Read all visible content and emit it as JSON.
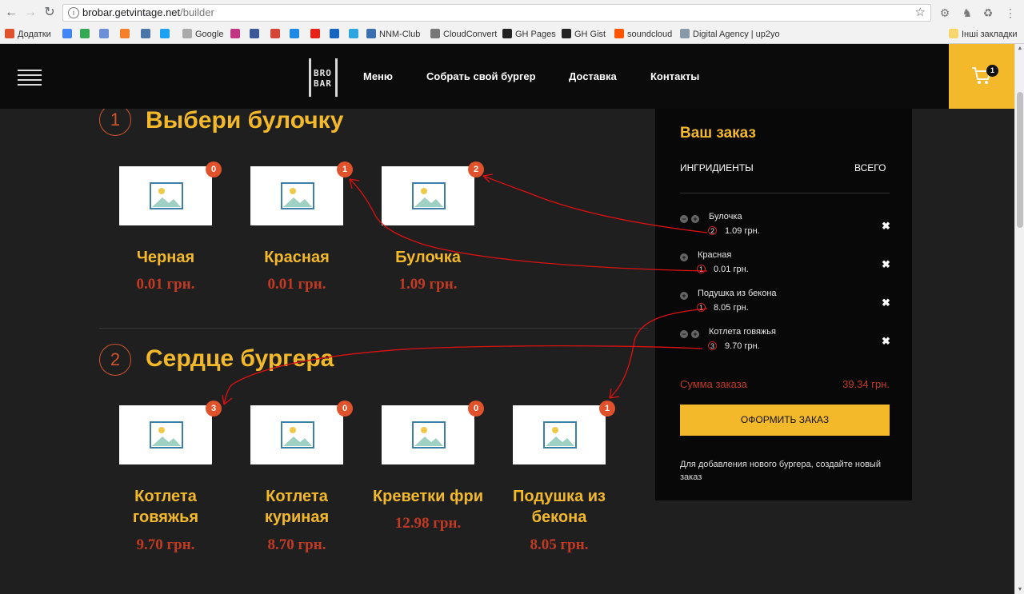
{
  "browser": {
    "url_host": "brobar.getvintage.net",
    "url_path": "/builder",
    "back_icon": "back-arrow-icon",
    "forward_icon": "forward-arrow-icon",
    "reload_icon": "reload-icon",
    "bookmarks": [
      {
        "label": "Додатки",
        "color": "#e0522b"
      },
      {
        "label": "",
        "color": "#4285f4"
      },
      {
        "label": "",
        "color": "#34a853"
      },
      {
        "label": "",
        "color": "#6d8fd8"
      },
      {
        "label": "",
        "color": "#f4802a"
      },
      {
        "label": "",
        "color": "#4a76a8"
      },
      {
        "label": "",
        "color": "#1da1f2"
      },
      {
        "label": "Google",
        "color": "#aaaaaa"
      },
      {
        "label": "",
        "color": "#c13584"
      },
      {
        "label": "",
        "color": "#3b5998"
      },
      {
        "label": "",
        "color": "#d44638"
      },
      {
        "label": "",
        "color": "#1e88e5"
      },
      {
        "label": "",
        "color": "#e62117"
      },
      {
        "label": "",
        "color": "#1565c0"
      },
      {
        "label": "",
        "color": "#2ca5e0"
      },
      {
        "label": "NNM-Club",
        "color": "#3a6fb0"
      },
      {
        "label": "CloudConvert",
        "color": "#777777"
      },
      {
        "label": "GH Pages",
        "color": "#222222"
      },
      {
        "label": "GH Gist",
        "color": "#222222"
      },
      {
        "label": "soundcloud",
        "color": "#ff5500"
      },
      {
        "label": "Digital Agency | up2yo",
        "color": "#8899aa"
      }
    ],
    "other_bookmarks": "Інші закладки"
  },
  "header": {
    "logo_line1": "BRO",
    "logo_line2": "BAR",
    "nav": [
      "Меню",
      "Собрать свой бургер",
      "Доставка",
      "Контакты"
    ],
    "cart_count": "1"
  },
  "sections": [
    {
      "number": "1",
      "title": "Выбери булочку",
      "items": [
        {
          "name": "Черная",
          "price": "0.01 грн.",
          "qty": "0"
        },
        {
          "name": "Красная",
          "price": "0.01 грн.",
          "qty": "1"
        },
        {
          "name": "Булочка",
          "price": "1.09 грн.",
          "qty": "2"
        }
      ]
    },
    {
      "number": "2",
      "title": "Сердце бургера",
      "items": [
        {
          "name": "Котлета говяжья",
          "price": "9.70 грн.",
          "qty": "3"
        },
        {
          "name": "Котлета куриная",
          "price": "8.70 грн.",
          "qty": "0"
        },
        {
          "name": "Креветки фри",
          "price": "12.98 грн.",
          "qty": "0"
        },
        {
          "name": "Подушка из бекона",
          "price": "8.05 грн.",
          "qty": "1"
        }
      ]
    }
  ],
  "order": {
    "title": "Ваш заказ",
    "col_ingredients": "ИНГРИДИЕНТЫ",
    "col_total": "ВСЕГО",
    "lines": [
      {
        "name": "Булочка",
        "count": "2",
        "price": "1.09 грн.",
        "remove": "✖"
      },
      {
        "name": "Красная",
        "count": "1",
        "price": "0.01 грн.",
        "remove": "✖"
      },
      {
        "name": "Подушка из бекона",
        "count": "1",
        "price": "8.05 грн.",
        "remove": "✖"
      },
      {
        "name": "Котлета говяжья",
        "count": "3",
        "price": "9.70 грн.",
        "remove": "✖"
      }
    ],
    "sum_label": "Сумма заказа",
    "sum_value": "39.34 грн.",
    "checkout_label": "ОФОРМИТЬ ЗАКАЗ",
    "note": "Для добавления нового бургера, создайте новый заказ"
  },
  "colors": {
    "accent": "#f3b92a",
    "price_red": "#c23a24",
    "badge": "#e0522b",
    "annotation": "#dd1111"
  }
}
